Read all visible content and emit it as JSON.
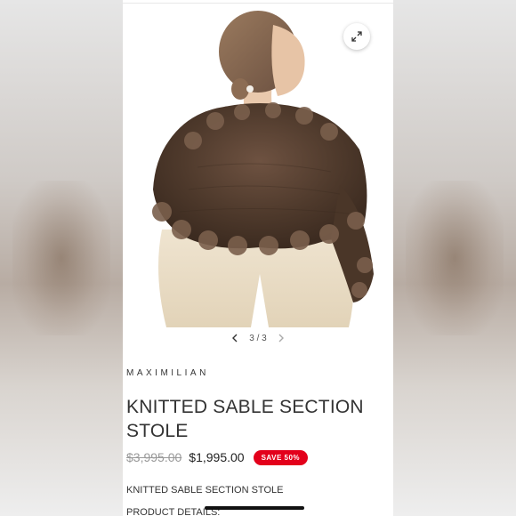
{
  "gallery": {
    "current": "3",
    "separator": "/",
    "total": "3",
    "expand_icon": "expand-icon",
    "prev_icon": "chevron-left-icon",
    "next_icon": "chevron-right-icon"
  },
  "product": {
    "brand": "MAXIMILIAN",
    "title": "KNITTED SABLE SECTION STOLE",
    "original_price": "$3,995.00",
    "sale_price": "$1,995.00",
    "badge": "SAVE 50%",
    "description": "KNITTED SABLE SECTION STOLE",
    "details_heading": "PRODUCT DETAILS:"
  },
  "colors": {
    "badge_bg": "#e3001b",
    "fur": "#5b4232",
    "sweater": "#e8dcc6"
  }
}
